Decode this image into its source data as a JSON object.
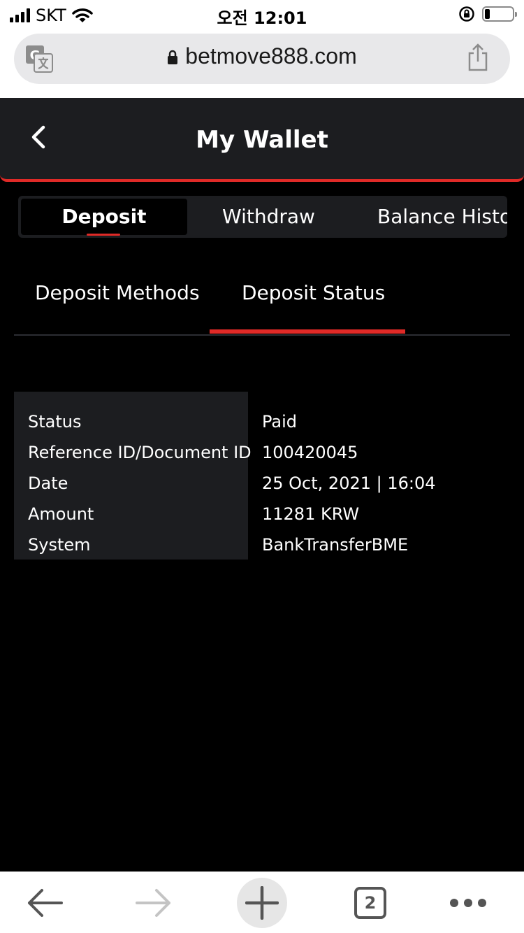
{
  "status_bar": {
    "carrier": "SKT",
    "time": "오전 12:01"
  },
  "browser": {
    "url": "betmove888.com",
    "icons": [
      "translate-icon",
      "lock-icon",
      "share-icon"
    ],
    "toolbar": {
      "tab_count": "2",
      "icons": [
        "back-arrow-icon",
        "forward-arrow-icon",
        "plus-icon",
        "tabs-icon",
        "more-icon"
      ]
    }
  },
  "header": {
    "title": "My Wallet",
    "back_icon": "chevron-left-icon"
  },
  "main_tabs": [
    {
      "label": "Deposit",
      "active": true
    },
    {
      "label": "Withdraw",
      "active": false
    },
    {
      "label": "Balance History",
      "active": false
    }
  ],
  "sub_tabs": [
    {
      "label": "Deposit Methods",
      "active": false
    },
    {
      "label": "Deposit Status",
      "active": true
    }
  ],
  "deposit_details": [
    {
      "label": "Status",
      "value": "Paid"
    },
    {
      "label": "Reference ID/Document ID",
      "value": "100420045"
    },
    {
      "label": "Date",
      "value": "25 Oct, 2021 | 16:04"
    },
    {
      "label": "Amount",
      "value": "11281 KRW"
    },
    {
      "label": "System",
      "value": "BankTransferBME"
    }
  ],
  "colors": {
    "accent": "#e02a27",
    "panel": "#1c1d20",
    "background": "#000000"
  }
}
